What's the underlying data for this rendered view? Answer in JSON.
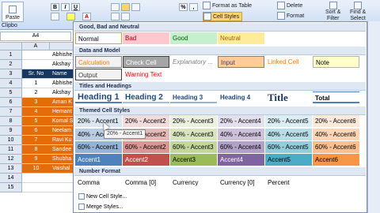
{
  "ribbon": {
    "paste_label": "Paste",
    "clipboard_label": "Clipbo",
    "format_as_table": "Format as Table",
    "cell_styles": "Cell Styles",
    "delete_label": "Delete",
    "format_label": "Format",
    "sort_filter_line1": "Sort &",
    "sort_filter_line2": "Filter",
    "find_select_line1": "Find &",
    "find_select_line2": "Select",
    "percent_symbol": "%",
    "comma_symbol": ",",
    "font_color_glyph": "A",
    "bold": "B",
    "italic": "I",
    "underline": "U"
  },
  "namebox": "A4",
  "columns": {
    "a": "A"
  },
  "rows": [
    {
      "num": "1",
      "a": "",
      "b": "Abhishe",
      "color": "#ffffff"
    },
    {
      "num": "2",
      "a": "",
      "b": "Akshay",
      "color": "#ffffff"
    },
    {
      "num": "3",
      "a": "Sr. No",
      "b": "Name",
      "color": "#17375e"
    },
    {
      "num": "4",
      "a": "1",
      "b": "Abhishe",
      "color": "#ffffff"
    },
    {
      "num": "5",
      "a": "2",
      "b": "Akshay",
      "color": "#ffffff"
    },
    {
      "num": "6",
      "a": "3",
      "b": "Aman K",
      "color": "#e46c0a"
    },
    {
      "num": "7",
      "a": "4",
      "b": "Hemant",
      "color": "#e46c0a"
    },
    {
      "num": "8",
      "a": "5",
      "b": "Komal S",
      "color": "#e46c0a"
    },
    {
      "num": "9",
      "a": "6",
      "b": "Neelam",
      "color": "#e46c0a"
    },
    {
      "num": "10",
      "a": "7",
      "b": "Ravi Ku",
      "color": "#e46c0a"
    },
    {
      "num": "11",
      "a": "8",
      "b": "Sandee",
      "color": "#e46c0a"
    },
    {
      "num": "12",
      "a": "9",
      "b": "Shubha",
      "color": "#e46c0a"
    },
    {
      "num": "13",
      "a": "10",
      "b": "Vaishal",
      "color": "#e46c0a"
    },
    {
      "num": "14",
      "a": "",
      "b": "",
      "color": "#ffffff"
    },
    {
      "num": "15",
      "a": "",
      "b": "",
      "color": "#ffffff"
    }
  ],
  "gallery": {
    "sections": {
      "good_bad_neutral": "Good, Bad and Neutral",
      "data_model": "Data and Model",
      "titles_headings": "Titles and Headings",
      "themed": "Themed Cell Styles",
      "number_format": "Number Format"
    },
    "gbn": [
      {
        "label": "Normal",
        "bg": "#ffffff",
        "fg": "#000000",
        "border": "#e3a21a"
      },
      {
        "label": "Bad",
        "bg": "#ffc7ce",
        "fg": "#9c0006",
        "border": ""
      },
      {
        "label": "Good",
        "bg": "#c6efce",
        "fg": "#006100",
        "border": ""
      },
      {
        "label": "Neutral",
        "bg": "#ffeb9c",
        "fg": "#9c6500",
        "border": ""
      }
    ],
    "data_model_row1": [
      {
        "label": "Calculation",
        "bg": "#f2f2f2",
        "fg": "#fa7d00",
        "border": "#7f7f7f"
      },
      {
        "label": "Check Cell",
        "bg": "#a5a5a5",
        "fg": "#ffffff",
        "border": "#3f3f3f"
      },
      {
        "label": "Explanatory ...",
        "bg": "#ffffff",
        "fg": "#7f7f7f",
        "border": ""
      },
      {
        "label": "Input",
        "bg": "#ffcc99",
        "fg": "#3f3f76",
        "border": "#7f7f7f"
      },
      {
        "label": "Linked Cell",
        "bg": "#ffffff",
        "fg": "#fa7d00",
        "border": ""
      },
      {
        "label": "Note",
        "bg": "#ffffcc",
        "fg": "#000000",
        "border": "#b2b2b2"
      }
    ],
    "data_model_row2": [
      {
        "label": "Output",
        "bg": "#f2f2f2",
        "fg": "#3f3f3f",
        "border": "#3f3f3f"
      },
      {
        "label": "Warning Text",
        "bg": "#ffffff",
        "fg": "#ff0000",
        "border": ""
      }
    ],
    "headings": [
      {
        "label": "Heading 1",
        "size": "11px",
        "under": "#4f81bd"
      },
      {
        "label": "Heading 2",
        "size": "10px",
        "under": "#a7bfde"
      },
      {
        "label": "Heading 3",
        "size": "8px",
        "under": "#95b3d7"
      },
      {
        "label": "Heading 4",
        "size": "8px",
        "under": ""
      },
      {
        "label": "Title",
        "size": "13px",
        "under": ""
      },
      {
        "label": "Total",
        "size": "8px",
        "under": "#4f81bd"
      }
    ],
    "themed_20": [
      {
        "label": "20% - Accent1",
        "bg": "#dce6f1"
      },
      {
        "label": "20% - Accent2",
        "bg": "#f2dcdb"
      },
      {
        "label": "20% - Accent3",
        "bg": "#ebf1de"
      },
      {
        "label": "20% - Accent4",
        "bg": "#e4dfec"
      },
      {
        "label": "20% - Accent5",
        "bg": "#daeef3"
      },
      {
        "label": "20% - Accent6",
        "bg": "#fde9d9"
      }
    ],
    "themed_40": [
      {
        "label": "40% - Accent1",
        "bg": "#b8cce4"
      },
      {
        "label": "40% - Accent2",
        "bg": "#e6b8b7"
      },
      {
        "label": "40% - Accent3",
        "bg": "#d8e4bc"
      },
      {
        "label": "40% - Accent4",
        "bg": "#ccc0da"
      },
      {
        "label": "40% - Accent5",
        "bg": "#b7dee8"
      },
      {
        "label": "40% - Accent6",
        "bg": "#fcd5b4"
      }
    ],
    "themed_60": [
      {
        "label": "60% - Accent1",
        "bg": "#95b3d7"
      },
      {
        "label": "60% - Accent2",
        "bg": "#da9694"
      },
      {
        "label": "60% - Accent3",
        "bg": "#c4d79b"
      },
      {
        "label": "60% - Accent4",
        "bg": "#b1a0c7"
      },
      {
        "label": "60% - Accent5",
        "bg": "#92cddc"
      },
      {
        "label": "60% - Accent6",
        "bg": "#fabf8f"
      }
    ],
    "accents": [
      {
        "label": "Accent1",
        "bg": "#4f81bd"
      },
      {
        "label": "Accent2",
        "bg": "#c0504d"
      },
      {
        "label": "Accent3",
        "bg": "#9bbb59"
      },
      {
        "label": "Accent4",
        "bg": "#8064a2"
      },
      {
        "label": "Accent5",
        "bg": "#4bacc6"
      },
      {
        "label": "Accent6",
        "bg": "#f79646"
      }
    ],
    "number_formats": [
      "Comma",
      "Comma [0]",
      "Currency",
      "Currency [0]",
      "Percent"
    ],
    "tooltip": "20% - Accent1",
    "menu": {
      "new_style": "New Cell Style...",
      "merge_styles": "Merge Styles..."
    }
  }
}
